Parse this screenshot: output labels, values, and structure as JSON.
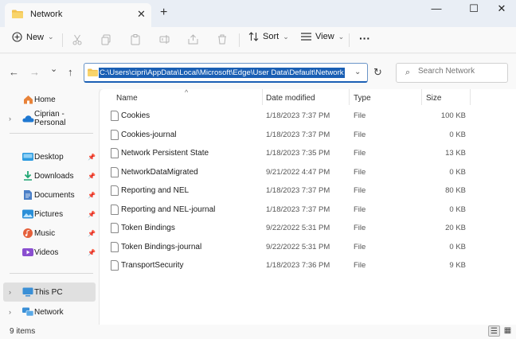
{
  "window": {
    "tab_title": "Network",
    "new_tab": "+",
    "minimize": "—",
    "maximize": "☐",
    "close": "✕",
    "tab_close": "✕"
  },
  "toolbar": {
    "new_label": "New",
    "sort_label": "Sort",
    "view_label": "View",
    "more_label": "···",
    "chevron": "⌄"
  },
  "nav": {
    "back": "←",
    "forward": "→",
    "recent": "⌄",
    "up": "↑",
    "address": "C:\\Users\\cipri\\AppData\\Local\\Microsoft\\Edge\\User Data\\Default\\Network",
    "address_dropdown": "⌄",
    "refresh": "↻",
    "search_placeholder": "Search Network",
    "search_icon": "⌕"
  },
  "sidebar": {
    "items": [
      {
        "label": "Home",
        "icon": "home-icon",
        "color": "#e8833a"
      },
      {
        "label": "Ciprian - Personal",
        "icon": "onedrive-icon",
        "color": "#1f78d1"
      },
      {
        "label": "Desktop",
        "icon": "desktop-icon",
        "color": "#2d9be0"
      },
      {
        "label": "Downloads",
        "icon": "downloads-icon",
        "color": "#1ea672"
      },
      {
        "label": "Documents",
        "icon": "documents-icon",
        "color": "#4a7fc7"
      },
      {
        "label": "Pictures",
        "icon": "pictures-icon",
        "color": "#2a8fd8"
      },
      {
        "label": "Music",
        "icon": "music-icon",
        "color": "#e5603b"
      },
      {
        "label": "Videos",
        "icon": "videos-icon",
        "color": "#8a4fd0"
      },
      {
        "label": "This PC",
        "icon": "this-pc-icon",
        "color": "#3a8fd6"
      },
      {
        "label": "Network",
        "icon": "network-icon",
        "color": "#3a8fd6"
      }
    ],
    "pin": "📌",
    "expand": "›"
  },
  "columns": {
    "name": "Name",
    "date": "Date modified",
    "type": "Type",
    "size": "Size",
    "sort_caret": "^"
  },
  "files": [
    {
      "name": "Cookies",
      "date": "1/18/2023 7:37 PM",
      "type": "File",
      "size": "100 KB"
    },
    {
      "name": "Cookies-journal",
      "date": "1/18/2023 7:37 PM",
      "type": "File",
      "size": "0 KB"
    },
    {
      "name": "Network Persistent State",
      "date": "1/18/2023 7:35 PM",
      "type": "File",
      "size": "13 KB"
    },
    {
      "name": "NetworkDataMigrated",
      "date": "9/21/2022 4:47 PM",
      "type": "File",
      "size": "0 KB"
    },
    {
      "name": "Reporting and NEL",
      "date": "1/18/2023 7:37 PM",
      "type": "File",
      "size": "80 KB"
    },
    {
      "name": "Reporting and NEL-journal",
      "date": "1/18/2023 7:37 PM",
      "type": "File",
      "size": "0 KB"
    },
    {
      "name": "Token Bindings",
      "date": "9/22/2022 5:31 PM",
      "type": "File",
      "size": "20 KB"
    },
    {
      "name": "Token Bindings-journal",
      "date": "9/22/2022 5:31 PM",
      "type": "File",
      "size": "0 KB"
    },
    {
      "name": "TransportSecurity",
      "date": "1/18/2023 7:36 PM",
      "type": "File",
      "size": "9 KB"
    }
  ],
  "status": {
    "item_count": "9 items",
    "details_view": "☰",
    "tiles_view": "▦"
  }
}
